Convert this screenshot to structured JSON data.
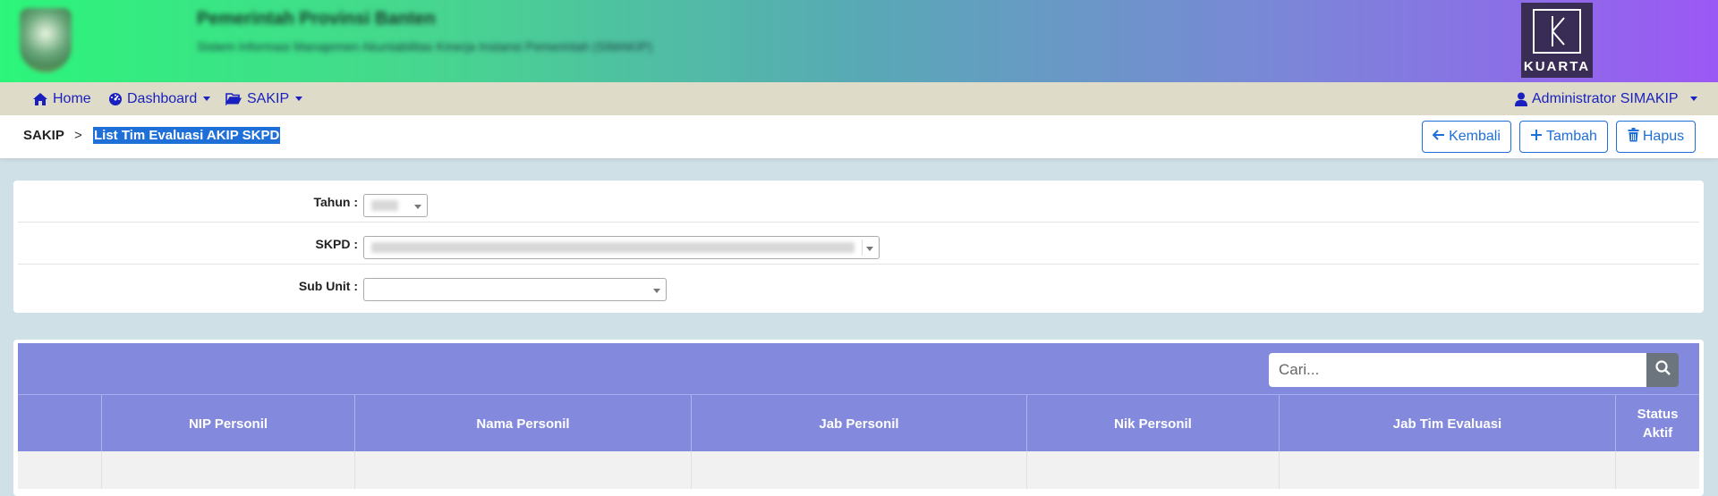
{
  "banner": {
    "title": "Pemerintah Provinsi Banten",
    "subtitle": "Sistem Informasi Manajemen Akuntabilitas Kinerja Instansi Pemerintah (SIMAKIP)",
    "partner_logo_text": "KUARTA"
  },
  "nav": {
    "home": "Home",
    "dashboard": "Dashboard",
    "sakip": "SAKIP",
    "user": "Administrator SIMAKIP"
  },
  "breadcrumb": {
    "root": "SAKIP",
    "separator": ">",
    "current": "List Tim Evaluasi AKIP SKPD"
  },
  "actions": {
    "back": "Kembali",
    "add": "Tambah",
    "delete": "Hapus"
  },
  "filters": {
    "tahun_label": "Tahun :",
    "skpd_label": "SKPD :",
    "subunit_label": "Sub Unit :"
  },
  "table": {
    "search_placeholder": "Cari...",
    "columns": [
      "",
      "NIP Personil",
      "Nama Personil",
      "Jab Personil",
      "Nik Personil",
      "Jab Tim Evaluasi",
      "Status Aktif"
    ]
  },
  "colors": {
    "accent": "#1e6fd8",
    "nav_link": "#1a1fbf",
    "table_header": "#8389dc"
  }
}
